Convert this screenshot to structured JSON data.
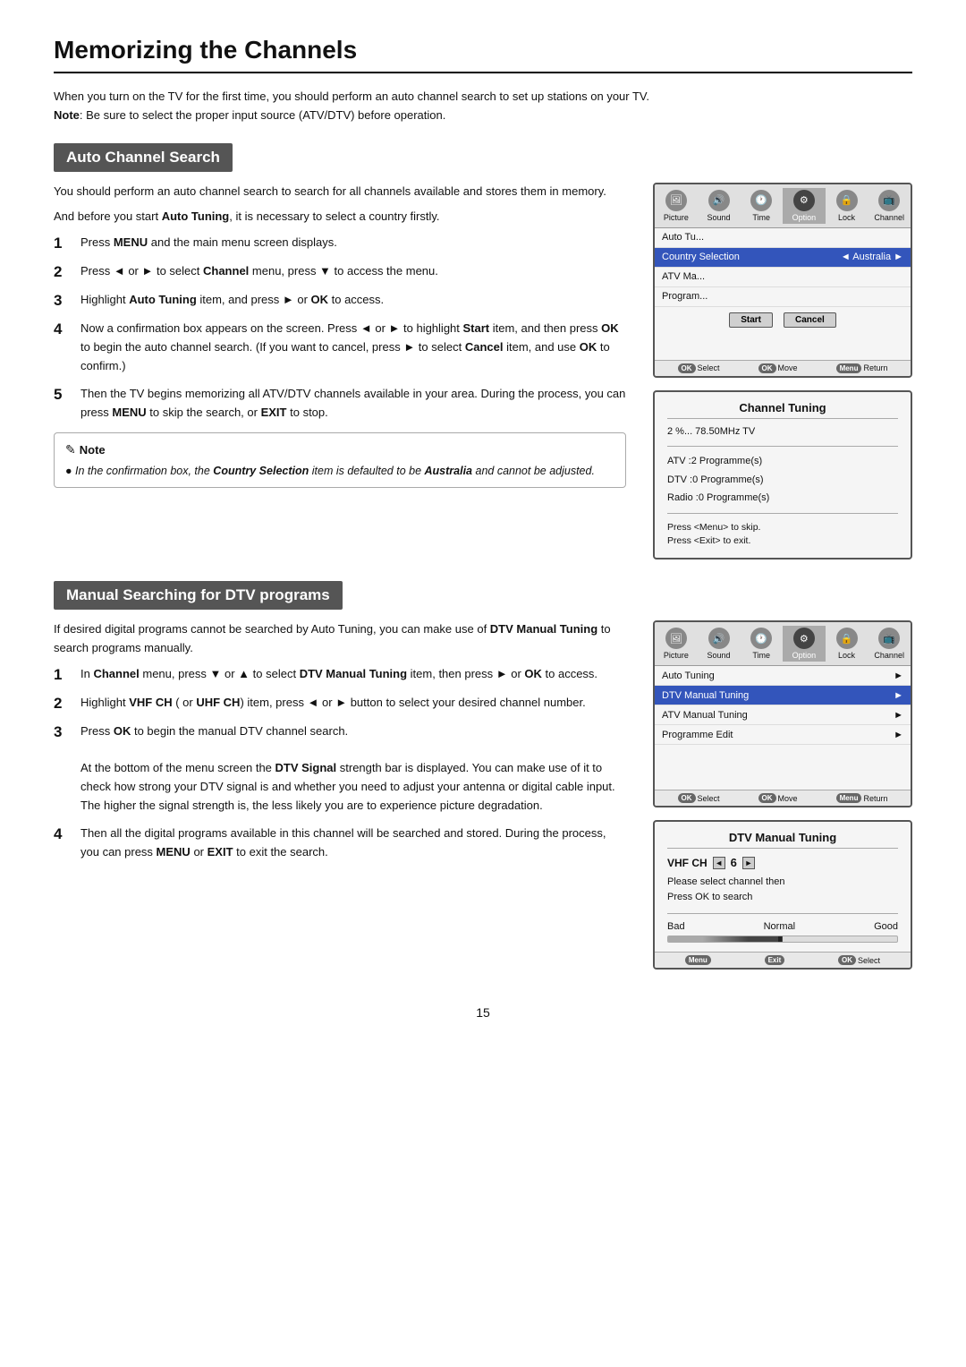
{
  "page": {
    "title": "Memorizing the Channels",
    "page_number": "15"
  },
  "intro": {
    "line1": "When you turn on the TV for the first time, you should perform an auto channel search to set up stations on your TV.",
    "note_label": "Note",
    "line2": ": Be sure to select the proper input source (ATV/DTV) before operation."
  },
  "auto_channel_search": {
    "header": "Auto Channel Search",
    "desc": "You should perform an auto channel search to search for all channels available and stores them in memory.",
    "desc2": "And before you start Auto Tuning, it is necessary to select a country firstly.",
    "steps": [
      {
        "num": "1",
        "text": "Press MENU and the main menu screen displays."
      },
      {
        "num": "2",
        "text": "Press ◄ or ► to select Channel menu,  press ▼  to access the menu."
      },
      {
        "num": "3",
        "text": "Highlight Auto Tuning item, and press ► or OK to access."
      },
      {
        "num": "4",
        "text": "Now a confirmation box appears on the screen. Press ◄ or ► to highlight Start item, and then press OK to begin the auto channel search. (If you want to cancel, press ► to select Cancel item, and use OK to confirm.)"
      },
      {
        "num": "5",
        "text": "Then the TV begins memorizing all ATV/DTV channels available in your area. During the process, you can press MENU to skip the search, or EXIT to stop."
      }
    ],
    "note": {
      "title": "Note",
      "bullet": "In the confirmation box, the Country Selection item is defaulted to be Australia and cannot be adjusted."
    }
  },
  "tv_menu1": {
    "icons": [
      {
        "label": "Picture",
        "char": "🖼"
      },
      {
        "label": "Sound",
        "char": "🔊"
      },
      {
        "label": "Time",
        "char": "🕐"
      },
      {
        "label": "Option",
        "char": "⚙",
        "active": true
      },
      {
        "label": "Lock",
        "char": "🔒"
      },
      {
        "label": "Channel",
        "char": "📺"
      }
    ],
    "rows": [
      {
        "label": "Auto Tu...",
        "value": "",
        "highlighted": false
      },
      {
        "label": "Country Selection",
        "value": "◄  Australia  ►",
        "highlighted": true
      },
      {
        "label": "ATV Ma...",
        "value": "",
        "highlighted": false
      },
      {
        "label": "Program...",
        "value": "",
        "highlighted": false
      }
    ],
    "buttons": [
      "Start",
      "Cancel"
    ],
    "footer": [
      {
        "btn": "OK",
        "label": "Select"
      },
      {
        "btn": "OK",
        "label": "Move"
      },
      {
        "btn": "Menu",
        "label": "Return"
      }
    ]
  },
  "channel_tuning": {
    "title": "Channel  Tuning",
    "progress": "2 %...   78.50MHz  TV",
    "atv": "ATV  :2   Programme(s)",
    "dtv": "DTV  :0   Programme(s)",
    "radio": "Radio  :0   Programme(s)",
    "note1": "Press <Menu> to skip.",
    "note2": "Press <Exit> to exit."
  },
  "manual_searching": {
    "header": "Manual Searching for DTV programs",
    "desc1": "If desired digital programs cannot be searched by Auto Tuning, you can make use of DTV Manual Tuning to search programs manually.",
    "steps": [
      {
        "num": "1",
        "text": "In Channel menu,  press ▼ or ▲  to select DTV Manual Tuning item, then press ► or OK to access."
      },
      {
        "num": "2",
        "text": "Highlight VHF CH ( or UHF CH) item, press ◄ or ► button to select your desired channel number."
      },
      {
        "num": "3",
        "text": "Press OK to begin the manual DTV  channel search.\n\nAt the bottom of the menu screen the DTV Signal strength bar is displayed. You can make use of it to check how strong your DTV signal is and whether you need to adjust your antenna or digital cable input. The higher the signal strength is, the less likely you are to experience picture degradation."
      },
      {
        "num": "4",
        "text": "Then all the digital programs available in this channel will be searched and stored. During the process, you can press MENU or EXIT to exit the search."
      }
    ]
  },
  "tv_menu2": {
    "icons": [
      {
        "label": "Picture",
        "char": "🖼"
      },
      {
        "label": "Sound",
        "char": "🔊"
      },
      {
        "label": "Time",
        "char": "🕐"
      },
      {
        "label": "Option",
        "char": "⚙",
        "active": true
      },
      {
        "label": "Lock",
        "char": "🔒"
      },
      {
        "label": "Channel",
        "char": "📺"
      }
    ],
    "rows": [
      {
        "label": "Auto Tuning",
        "value": "►"
      },
      {
        "label": "DTV Manual Tuning",
        "value": "►",
        "highlighted": true
      },
      {
        "label": "ATV Manual Tuning",
        "value": "►"
      },
      {
        "label": "Programme Edit",
        "value": "►"
      }
    ],
    "footer": [
      {
        "btn": "OK",
        "label": "Select"
      },
      {
        "btn": "OK",
        "label": "Move"
      },
      {
        "btn": "Menu",
        "label": "Return"
      }
    ]
  },
  "dtv_manual_tuning": {
    "title": "DTV Manual Tuning",
    "vhf_label": "VHF  CH",
    "ch_value": "6",
    "desc1": "Please select channel then",
    "desc2": "Press OK to search",
    "signal_labels": {
      "bad": "Bad",
      "normal": "Normal",
      "good": "Good"
    },
    "footer": [
      {
        "btn": "Menu",
        "label": ""
      },
      {
        "btn": "Exit",
        "label": ""
      },
      {
        "btn": "OK",
        "label": "Select"
      }
    ]
  }
}
